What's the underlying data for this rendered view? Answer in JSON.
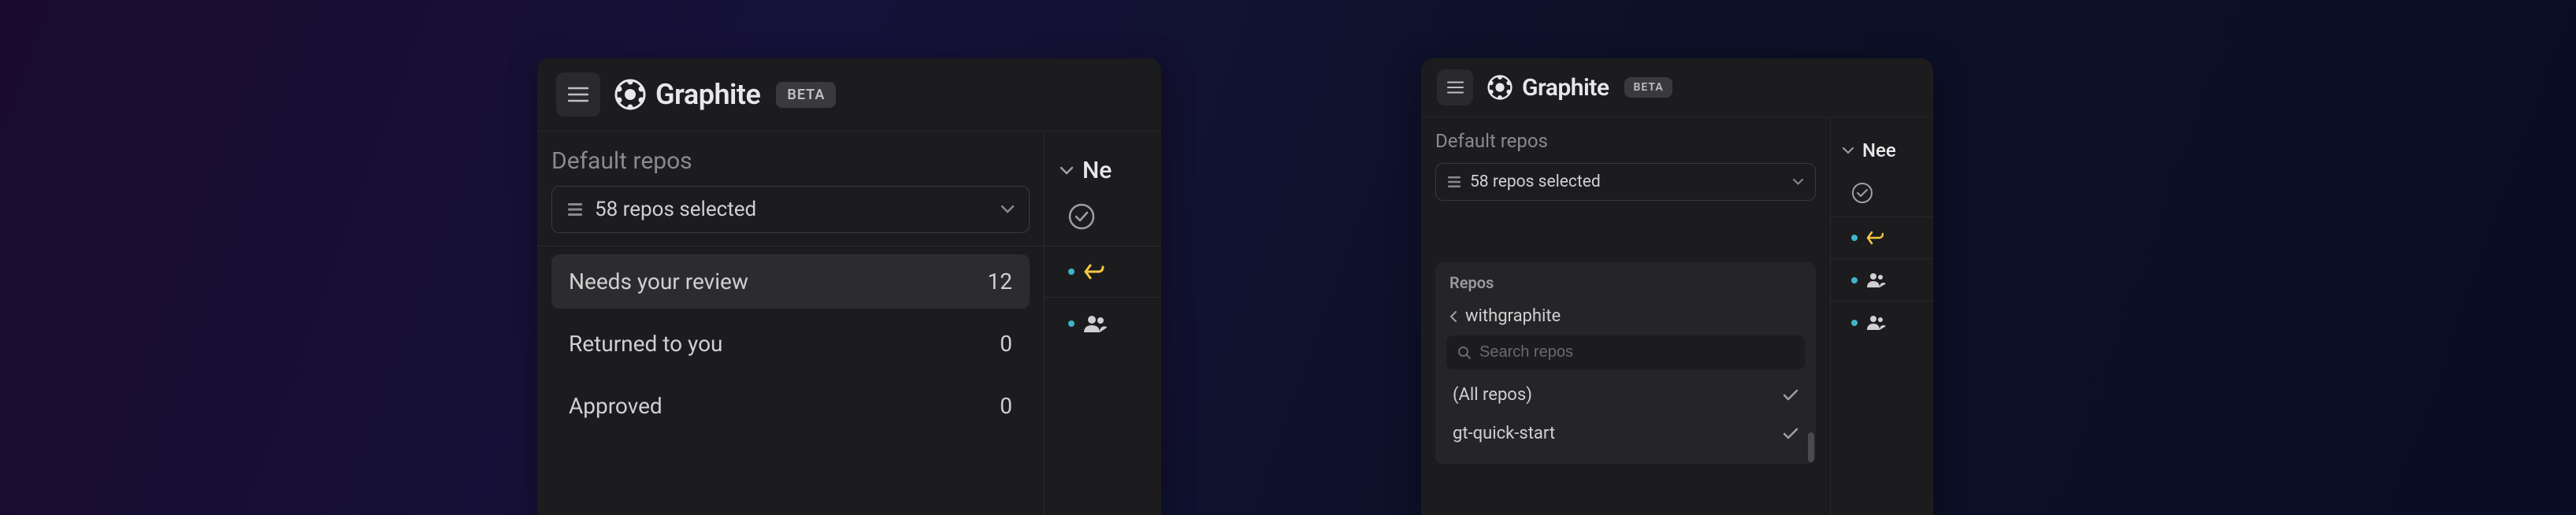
{
  "brand": {
    "name": "Graphite",
    "beta": "BETA"
  },
  "sidebar": {
    "section_label": "Default repos",
    "dropdown_text": "58 repos selected",
    "items": [
      {
        "label": "Needs your review",
        "count": "12",
        "active": true
      },
      {
        "label": "Returned to you",
        "count": "0",
        "active": false
      },
      {
        "label": "Approved",
        "count": "0",
        "active": false
      }
    ]
  },
  "main": {
    "title_truncated": "Ne",
    "title_right": "Nee"
  },
  "popover": {
    "label": "Repos",
    "breadcrumb": "withgraphite",
    "search_placeholder": "Search repos",
    "items": [
      {
        "label": "(All repos)",
        "checked": true
      },
      {
        "label": "gt-quick-start",
        "checked": true
      }
    ]
  }
}
